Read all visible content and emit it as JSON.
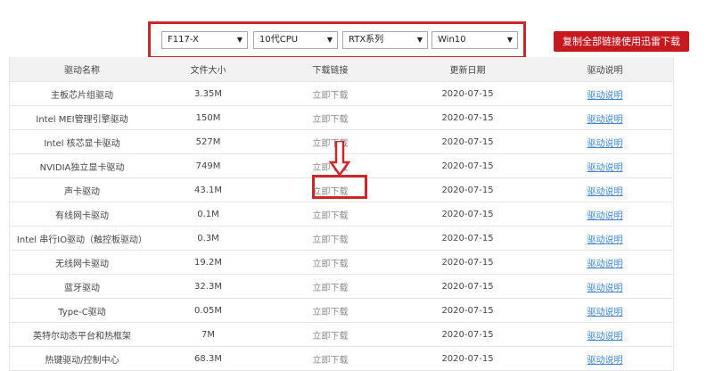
{
  "filters": {
    "model": "F117-X",
    "cpu": "10代CPU",
    "gpu": "RTX系列",
    "os": "Win10"
  },
  "download_all_label": "复制全部链接使用迅雷下载",
  "table": {
    "headers": [
      "驱动名称",
      "文件大小",
      "下载链接",
      "更新日期",
      "驱动说明"
    ],
    "rows": [
      {
        "name": "主板芯片组驱动",
        "size": "3.35M",
        "link": "立即下载",
        "date": "2020-07-15",
        "info": "驱动说明"
      },
      {
        "name": "Intel MEI管理引擎驱动",
        "size": "150M",
        "link": "立即下载",
        "date": "2020-07-15",
        "info": "驱动说明"
      },
      {
        "name": "Intel 核芯显卡驱动",
        "size": "527M",
        "link": "立即下载",
        "date": "2020-07-15",
        "info": "驱动说明"
      },
      {
        "name": "NVIDIA独立显卡驱动",
        "size": "749M",
        "link": "立即下载",
        "date": "2020-07-15",
        "info": "驱动说明"
      },
      {
        "name": "声卡驱动",
        "size": "43.1M",
        "link": "立即下载",
        "date": "2020-07-15",
        "info": "驱动说明"
      },
      {
        "name": "有线网卡驱动",
        "size": "0.1M",
        "link": "立即下载",
        "date": "2020-07-15",
        "info": "驱动说明"
      },
      {
        "name": "Intel 串行IO驱动（触控板驱动）",
        "size": "0.3M",
        "link": "立即下载",
        "date": "2020-07-15",
        "info": "驱动说明"
      },
      {
        "name": "无线网卡驱动",
        "size": "19.2M",
        "link": "立即下载",
        "date": "2020-07-15",
        "info": "驱动说明"
      },
      {
        "name": "蓝牙驱动",
        "size": "32.3M",
        "link": "立即下载",
        "date": "2020-07-15",
        "info": "驱动说明"
      },
      {
        "name": "Type-C驱动",
        "size": "0.05M",
        "link": "立即下载",
        "date": "2020-07-15",
        "info": "驱动说明"
      },
      {
        "name": "英特尔动态平台和热框架",
        "size": "7M",
        "link": "立即下载",
        "date": "2020-07-15",
        "info": "驱动说明"
      },
      {
        "name": "热键驱动/控制中心",
        "size": "68.3M",
        "link": "立即下载",
        "date": "2020-07-15",
        "info": "驱动说明"
      }
    ]
  },
  "colors": {
    "accent_red": "#c6181f",
    "link_blue": "#3b86d8"
  }
}
